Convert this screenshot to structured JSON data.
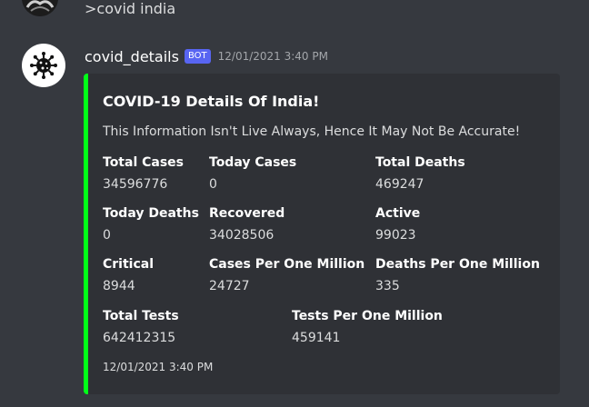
{
  "previous_message": {
    "text": ">covid india"
  },
  "message": {
    "username": "covid_details",
    "bot_tag": "BOT",
    "timestamp": "12/01/2021 3:40 PM",
    "embed": {
      "color": "#00ff18",
      "title": "COVID-19 Details Of India!",
      "description": "This Information Isn't Live Always, Hence It May Not Be Accurate!",
      "fields": [
        {
          "name": "Total Cases",
          "value": "34596776"
        },
        {
          "name": "Today Cases",
          "value": "0"
        },
        {
          "name": "Total Deaths",
          "value": "469247"
        },
        {
          "name": "Today Deaths",
          "value": "0"
        },
        {
          "name": "Recovered",
          "value": "34028506"
        },
        {
          "name": "Active",
          "value": "99023"
        },
        {
          "name": "Critical",
          "value": "8944"
        },
        {
          "name": "Cases Per One Million",
          "value": "24727"
        },
        {
          "name": "Deaths Per One Million",
          "value": "335"
        },
        {
          "name": "Total Tests",
          "value": "642412315"
        },
        {
          "name": "Tests Per One Million",
          "value": "459141"
        }
      ],
      "footer": "12/01/2021 3:40 PM"
    }
  },
  "colors": {
    "background": "#36393f",
    "embed_bg": "#2f3136",
    "bot_tag": "#5865f2"
  },
  "icons": {
    "avatar": "virus-icon"
  }
}
